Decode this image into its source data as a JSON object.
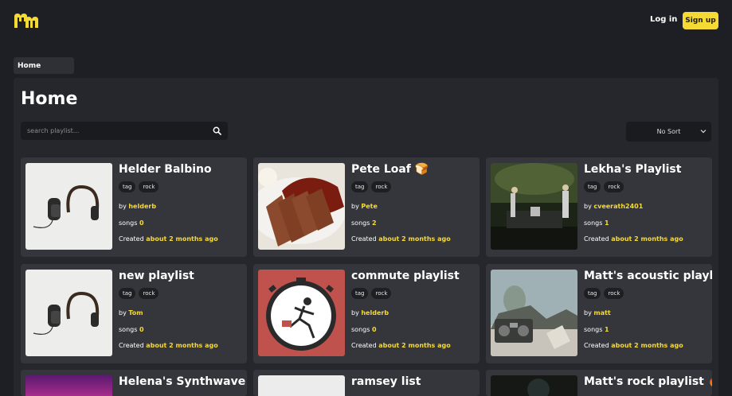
{
  "header": {
    "login_label": "Log in",
    "signup_label": "Sign up"
  },
  "breadcrumb": {
    "label": "Home"
  },
  "page": {
    "title": "Home"
  },
  "search": {
    "placeholder": "search playlist..."
  },
  "sort": {
    "selected": "No Sort"
  },
  "labels": {
    "by": "by",
    "songs": "songs",
    "created": "Created"
  },
  "playlists": [
    {
      "title": "Helder Balbino",
      "tags": [
        "tag",
        "rock"
      ],
      "author": "helderb",
      "songs": "0",
      "created": "about 2 months ago"
    },
    {
      "title": "Pete Loaf 🍞",
      "tags": [
        "tag",
        "rock"
      ],
      "author": "Pete",
      "songs": "2",
      "created": "about 2 months ago"
    },
    {
      "title": "Lekha's Playlist",
      "tags": [
        "tag",
        "rock"
      ],
      "author": "cveerath2401",
      "songs": "1",
      "created": "about 2 months ago"
    },
    {
      "title": "new playlist",
      "tags": [
        "tag",
        "rock"
      ],
      "author": "Tom",
      "songs": "0",
      "created": "about 2 months ago"
    },
    {
      "title": "commute playlist",
      "tags": [
        "tag",
        "rock"
      ],
      "author": "helderb",
      "songs": "0",
      "created": "about 2 months ago"
    },
    {
      "title": "Matt's acoustic playl",
      "tags": [
        "tag",
        "rock"
      ],
      "author": "matt",
      "songs": "1",
      "created": "about 2 months ago"
    },
    {
      "title": "Helena's Synthwave",
      "tags": [],
      "author": "",
      "songs": "",
      "created": ""
    },
    {
      "title": "ramsey list",
      "tags": [],
      "author": "",
      "songs": "",
      "created": ""
    },
    {
      "title": "Matt's rock playlist 🔥",
      "tags": [],
      "author": "",
      "songs": "",
      "created": ""
    }
  ]
}
